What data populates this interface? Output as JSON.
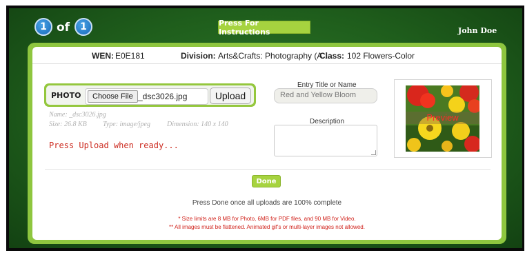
{
  "pager": {
    "current": "1",
    "of": "of",
    "total": "1"
  },
  "header": {
    "instructions_button": "Press For Instructions",
    "user_name": "John Doe"
  },
  "info": {
    "wen_label": "WEN:",
    "wen_value": "E0E181",
    "division_label": "Division:",
    "division_value": "Arts&Crafts: Photography (A...",
    "class_label": "Class:",
    "class_value": "102 Flowers-Color"
  },
  "upload": {
    "photo_label": "PHOTO",
    "choose_file_button": "Choose File",
    "file_name": "_dsc3026.jpg",
    "upload_button": "Upload",
    "meta_name": "Name: _dsc3026.jpg",
    "meta_size": "Size: 26.8 KB",
    "meta_type": "Type: image/jpeg",
    "meta_dimension": "Dimension: 140 x 140",
    "status": "Press Upload when ready..."
  },
  "entry": {
    "title_label": "Entry Title or Name",
    "title_value": "Red and Yellow Bloom",
    "description_label": "Description",
    "description_value": ""
  },
  "preview": {
    "overlay_text": "Preview"
  },
  "footer": {
    "done_button": "Done",
    "done_message": "Press Done once all uploads are 100% complete",
    "note_1": "* Size limits are 8 MB for Photo, 6MB for PDF files, and 90 MB for Video.",
    "note_2": "** All images must be flattened.  Animated gif's or multi-layer images not allowed."
  },
  "colors": {
    "accent_green": "#94c73d",
    "badge_blue": "#1769b8",
    "status_red": "#cc2a1f",
    "background_green": "#1f5e1c"
  }
}
